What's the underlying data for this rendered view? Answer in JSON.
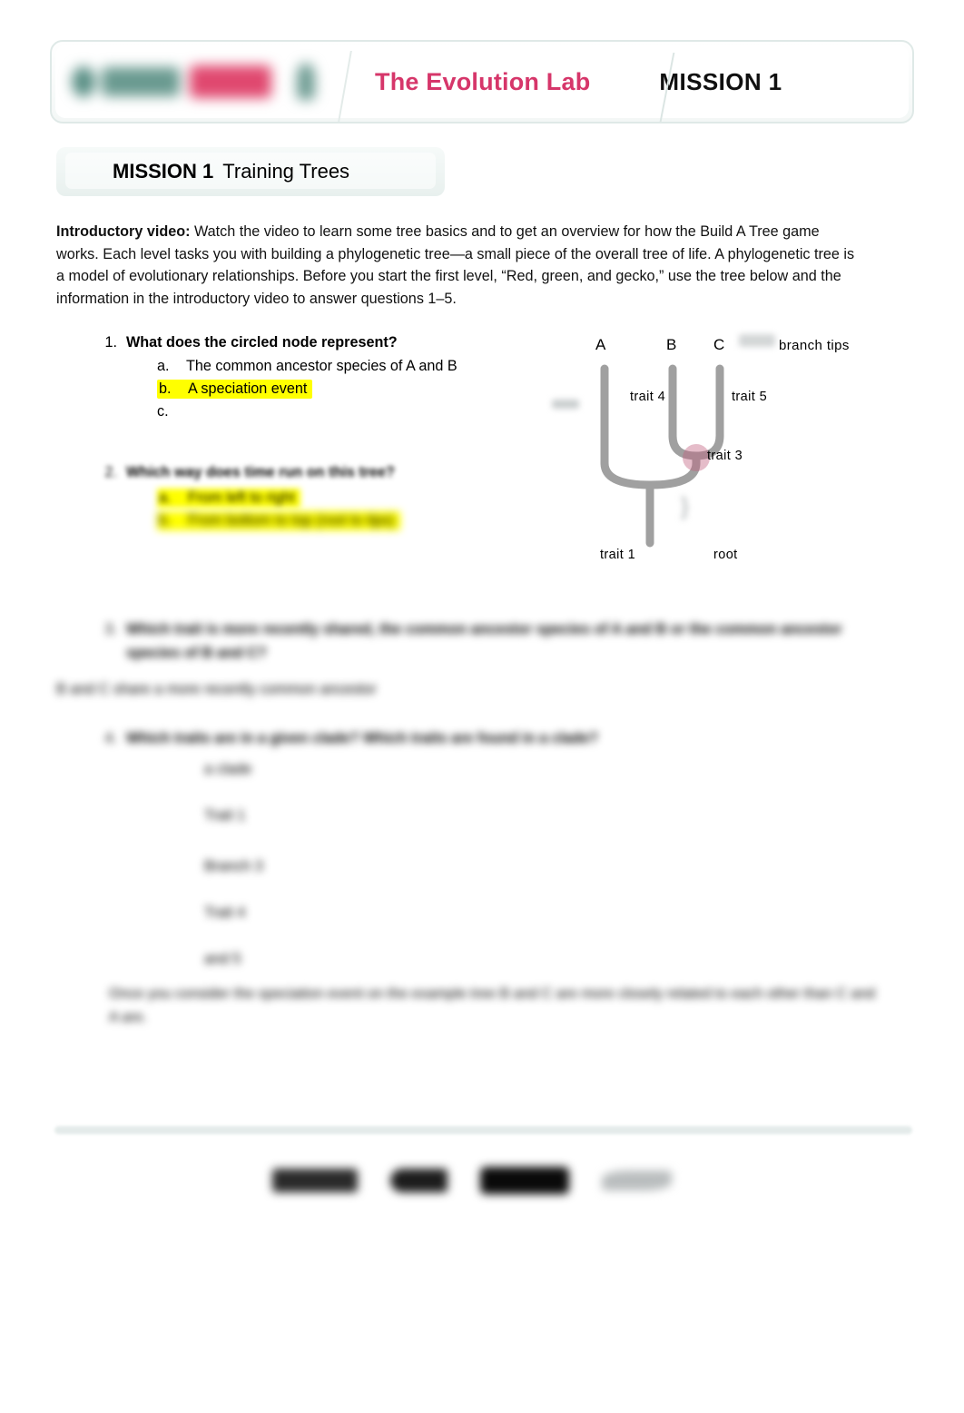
{
  "header": {
    "brand_title": "The Evolution Lab",
    "mission_badge": "MISSION 1",
    "brand_color": "#d6366a",
    "logo_alt": "evolution-lab-logo"
  },
  "mission_pill": {
    "label_bold": "MISSION 1",
    "label_rest": "Training Trees"
  },
  "intro": {
    "lead": "Introductory video:",
    "body": " Watch the video to learn some tree basics and to get an overview for how the Build A Tree game works. Each level tasks you with building a phylogenetic tree—a small piece of the overall tree of life. A phylogenetic tree is a model of evolutionary relationships. Before you start the first level, “Red, green, and gecko,” use the tree below and the information in the introductory video to answer questions 1–5."
  },
  "questions": [
    {
      "number": "1.",
      "stem": "What does the circled node represent?",
      "choices": [
        {
          "letter": "a.",
          "text": "The common ancestor species of A and B",
          "highlighted": false
        },
        {
          "letter": "b.",
          "text": "A speciation event",
          "highlighted": true
        },
        {
          "letter": "c.",
          "text": "",
          "highlighted": false
        }
      ]
    },
    {
      "number": "2.",
      "stem": "Which way does time run on this tree?",
      "choices": [
        {
          "letter": "a.",
          "text": "From left to right",
          "highlighted": false,
          "obscured": true
        },
        {
          "letter": "b.",
          "text": "From bottom to top (root to tips)",
          "highlighted": true,
          "obscured": true
        }
      ]
    },
    {
      "number": "3.",
      "stem": "Which trait is more recently shared, the common ancestor species of A and B or the common ancestor species of B and C?",
      "obscured": true,
      "answer": "B and C share a more recently common ancestor",
      "answer_obscured": true
    },
    {
      "number": "4.",
      "stem": "Which traits are in a given clade? Which traits are found in a clade?",
      "obscured": true,
      "answer_lines": [
        "a clade",
        "Trait 1",
        "Branch 3",
        "Trait 4",
        "and 5"
      ],
      "answer_obscured": true
    }
  ],
  "trailer_paragraph": {
    "text": "Once you consider the speciation event on the example tree B and C are more closely related to each other than C and A are.",
    "obscured": true
  },
  "tree_figure": {
    "name": "phylogenetic-tree-diagram",
    "tip_labels": [
      "A",
      "B",
      "C"
    ],
    "annotations": {
      "branch_tips": "branch tips",
      "root": "root"
    },
    "trait_labels": [
      "trait 4",
      "trait 5",
      "trait 3",
      "trait 1"
    ],
    "branch_color": "#8c8c8c",
    "circled_node_color": "#c0607f",
    "circled_node_label": "circled-node"
  },
  "footer": {
    "logos": [
      "footer-logo-1",
      "footer-logo-2",
      "footer-logo-3",
      "footer-logo-4"
    ]
  }
}
